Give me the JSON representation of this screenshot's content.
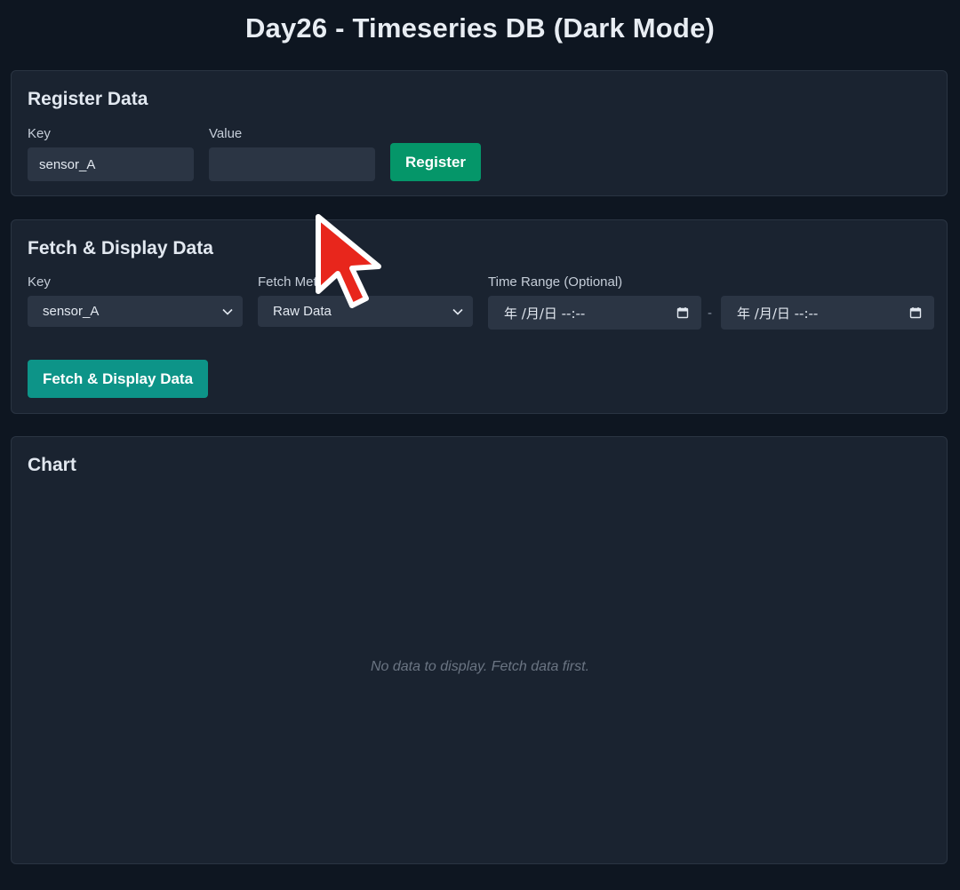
{
  "page": {
    "title": "Day26 - Timeseries DB (Dark Mode)"
  },
  "register": {
    "title": "Register Data",
    "key_label": "Key",
    "key_value": "sensor_A",
    "value_label": "Value",
    "value_value": "",
    "button_label": "Register"
  },
  "fetch": {
    "title": "Fetch & Display Data",
    "key_label": "Key",
    "key_selected": "sensor_A",
    "method_label": "Fetch Meth",
    "method_selected": "Raw Data",
    "range_label": "Time Range (Optional)",
    "range_start": "年 /月/日 --:--",
    "range_separator": "-",
    "range_end": "年 /月/日 --:--",
    "button_label": "Fetch & Display Data"
  },
  "chart": {
    "title": "Chart",
    "empty_message": "No data to display. Fetch data first."
  },
  "colors": {
    "background": "#0e1621",
    "card": "#1a2330",
    "register_button": "#059669",
    "fetch_button": "#0d9488",
    "cursor": "#e8261c"
  },
  "icons": {
    "select_arrow": "chevron-down-icon",
    "date_picker": "calendar-icon",
    "pointer": "mouse-cursor-icon"
  }
}
